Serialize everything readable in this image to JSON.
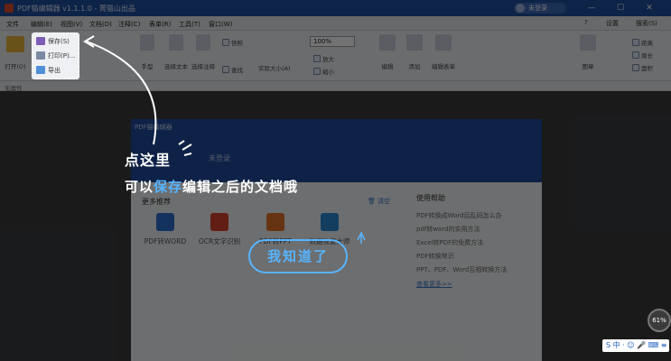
{
  "titlebar": {
    "title": "PDF猫编辑器 v1.1.1.0 - 菁猫山出品",
    "user_label": "未登录",
    "min": "—",
    "max": "☐",
    "close": "✕"
  },
  "menu": {
    "items": [
      "文件",
      "编辑(E)",
      "视图(V)",
      "文档(D)",
      "注释(C)",
      "表单(R)",
      "工具(T)",
      "窗口(W)"
    ],
    "right": [
      "设置",
      "搜索(S)"
    ],
    "help_glyph": "?"
  },
  "ribbon": {
    "open_label": "打开(O)",
    "file_group": {
      "save": "保存(S)",
      "print": "打印(P)...",
      "export": "导出"
    },
    "hand_label": "手型",
    "select_text_label": "选择文本",
    "select_annot_label": "选择注释",
    "snapshot_label": "快照",
    "find_label": "查找",
    "actual_size_label": "实际大小(A)",
    "zoom_value": "100%",
    "zoom_in_label": "放大",
    "zoom_out_label": "缩小",
    "edit_label": "编辑",
    "add_label": "添加",
    "edit_form_label": "编辑表单",
    "stamp_label": "图章",
    "right_items": [
      "距离",
      "周长",
      "面积"
    ]
  },
  "nav": {
    "label": "无属性"
  },
  "panel": {
    "title": "PDF猫编辑器",
    "login": "未登录",
    "more_title": "更多推荐",
    "clear_label": "清空",
    "tiles": [
      {
        "label": "PDF转WORD",
        "color": "#2e6fd0"
      },
      {
        "label": "OCR文字识别",
        "color": "#d9442e"
      },
      {
        "label": "PDF转PPT",
        "color": "#e3732b"
      },
      {
        "label": "数据恢复大师",
        "color": "#2a89d6"
      }
    ],
    "help_title": "使用帮助",
    "help_items": [
      "PDF转换成Word后乱码怎么办",
      "pdf转word的实用方法",
      "Excel转PDF的免费方法",
      "PDF转换常识",
      "PPT、PDF、Word互相转换方法"
    ],
    "help_more": "查看更多>>"
  },
  "guide": {
    "line1": "点这里",
    "line2_pre": "可以",
    "line2_hl": "保存",
    "line2_post": "编辑之后的文档哦",
    "ok": "我知道了"
  },
  "tray": {
    "ime": "S 中 · ☺ 🎤 ⌨ ≡",
    "cpu": "61%"
  }
}
